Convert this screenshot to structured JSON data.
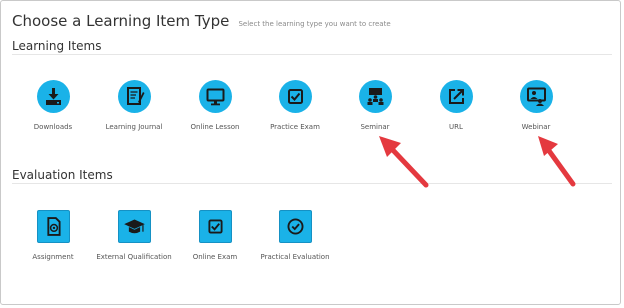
{
  "header": {
    "title": "Choose a Learning Item Type",
    "subtitle": "Select the learning type you want to create"
  },
  "learning_items": {
    "heading": "Learning Items",
    "items": [
      {
        "label": "Downloads",
        "icon": "download-icon"
      },
      {
        "label": "Learning Journal",
        "icon": "journal-icon"
      },
      {
        "label": "Online Lesson",
        "icon": "monitor-icon"
      },
      {
        "label": "Practice Exam",
        "icon": "checkbox-icon"
      },
      {
        "label": "Seminar",
        "icon": "seminar-icon"
      },
      {
        "label": "URL",
        "icon": "external-link-icon"
      },
      {
        "label": "Webinar",
        "icon": "webinar-icon"
      }
    ]
  },
  "evaluation_items": {
    "heading": "Evaluation Items",
    "items": [
      {
        "label": "Assignment",
        "icon": "assignment-icon"
      },
      {
        "label": "External Qualification",
        "icon": "graduation-cap-icon"
      },
      {
        "label": "Online Exam",
        "icon": "checkbox-icon"
      },
      {
        "label": "Practical Evaluation",
        "icon": "check-circle-icon"
      }
    ]
  },
  "colors": {
    "icon_background": "#1ab2e8",
    "annotation_arrow": "#e4393f"
  }
}
